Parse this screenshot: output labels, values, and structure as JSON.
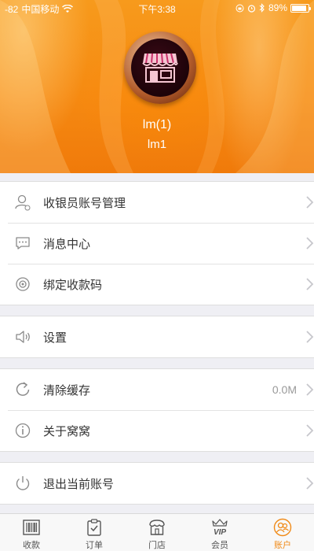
{
  "status_bar": {
    "signal": "-82",
    "carrier": "中国移动",
    "time": "下午3:38",
    "battery_text": "89%",
    "battery_level": 0.89
  },
  "profile": {
    "name": "lm(1)",
    "account": "lm1"
  },
  "menu_groups": [
    {
      "items": [
        {
          "label": "收银员账号管理",
          "icon": "user-icon"
        },
        {
          "label": "消息中心",
          "icon": "message-icon"
        },
        {
          "label": "绑定收款码",
          "icon": "qr-code-icon"
        }
      ]
    },
    {
      "items": [
        {
          "label": "设置",
          "icon": "speaker-icon"
        }
      ]
    },
    {
      "items": [
        {
          "label": "清除缓存",
          "icon": "refresh-icon",
          "value": "0.0M"
        },
        {
          "label": "关于窝窝",
          "icon": "info-icon"
        }
      ]
    },
    {
      "items": [
        {
          "label": "退出当前账号",
          "icon": "power-icon"
        }
      ]
    }
  ],
  "tabbar": {
    "items": [
      {
        "label": "收款",
        "icon": "barcode-icon"
      },
      {
        "label": "订单",
        "icon": "clipboard-icon"
      },
      {
        "label": "门店",
        "icon": "store-icon"
      },
      {
        "label": "会员",
        "icon": "vip-crown-icon",
        "badge_text": "VIP"
      },
      {
        "label": "账户",
        "icon": "account-icon",
        "active": true
      }
    ]
  },
  "colors": {
    "accent": "#f08a17",
    "header_orange": "#f68a12",
    "background": "#efeff4"
  }
}
